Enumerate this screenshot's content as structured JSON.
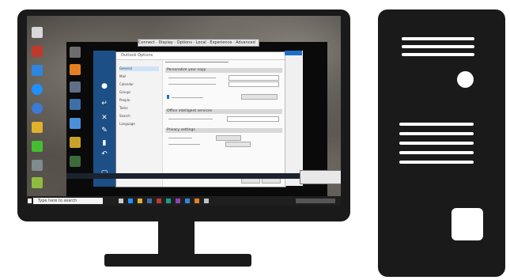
{
  "mini_bar": {
    "text": "Connect · Display · Options · Local · Experience · Advanced"
  },
  "settings": {
    "title": "Outlook Options",
    "nav": [
      "General",
      "Mail",
      "Calendar",
      "Groups",
      "People",
      "Tasks",
      "Search",
      "Language"
    ],
    "sections": [
      "Personalize your copy",
      "Office intelligent services",
      "Privacy settings"
    ]
  },
  "taskbar": {
    "search_placeholder": "Type here to search"
  },
  "colors": {
    "device_body": "#1a1a1a",
    "rail_blue": "#1b4f86",
    "accent_blue": "#1d6fc9"
  }
}
